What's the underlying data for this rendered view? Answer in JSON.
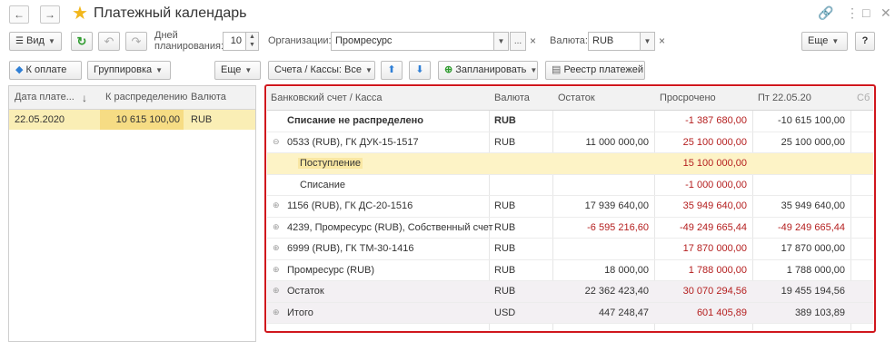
{
  "window": {
    "title": "Платежный календарь",
    "back_icon": "←",
    "forward_icon": "→",
    "star_icon": "★",
    "link_icon": "🔗",
    "menu_icon": "⋮",
    "maximize_icon": "□",
    "close_icon": "✕"
  },
  "toolbar1": {
    "view_label": "Вид",
    "refresh_icon": "↻",
    "undo_icon": "↶",
    "redo_icon": "↷",
    "days_label_1": "Дней",
    "days_label_2": "планирования:",
    "days_value": "10",
    "org_label": "Организации:",
    "org_value": "Промресурс",
    "currency_label": "Валюта:",
    "currency_value": "RUB",
    "more_label": "Еще",
    "help_label": "?",
    "clear_icon": "×",
    "dots_label": "..."
  },
  "toolbar2": {
    "pay_label": "К оплате",
    "group_label": "Группировка",
    "more_label": "Еще",
    "accounts_label": "Счета / Кассы: Все",
    "up_icon": "⬆",
    "down_icon": "⬇",
    "plan_label": "Запланировать",
    "registry_label": "Реестр платежей"
  },
  "left_table": {
    "headers": [
      "Дата плате...",
      "↓",
      "К распределению",
      "Валюта"
    ],
    "rows": [
      {
        "date": "22.05.2020",
        "amount": "10 615 100,00",
        "currency": "RUB"
      }
    ]
  },
  "right_table": {
    "headers": [
      "Банковский счет / Касса",
      "Валюта",
      "Остаток",
      "Просрочено",
      "Пт 22.05.20",
      "Сб"
    ],
    "rows": [
      {
        "name": "Списание не распределено",
        "currency": "RUB",
        "balance": "",
        "overdue": "-1 387 680,00",
        "day": "-10 615 100,00"
      },
      {
        "name": "0533 (RUB), ГК ДУК-15-1517",
        "currency": "RUB",
        "balance": "11 000 000,00",
        "overdue": "25 100 000,00",
        "day": "25 100 000,00"
      },
      {
        "name": "Поступление",
        "currency": "",
        "balance": "",
        "overdue": "15 100 000,00",
        "day": ""
      },
      {
        "name": "Списание",
        "currency": "",
        "balance": "",
        "overdue": "-1 000 000,00",
        "day": ""
      },
      {
        "name": "1156 (RUB), ГК ДС-20-1516",
        "currency": "RUB",
        "balance": "17 939 640,00",
        "overdue": "35 949 640,00",
        "day": "35 949 640,00"
      },
      {
        "name": "4239, Промресурс (RUB), Собственный счет",
        "currency": "RUB",
        "balance": "-6 595 216,60",
        "overdue": "-49 249 665,44",
        "day": "-49 249 665,44"
      },
      {
        "name": "6999 (RUB), ГК ТМ-30-1416",
        "currency": "RUB",
        "balance": "",
        "overdue": "17 870 000,00",
        "day": "17 870 000,00"
      },
      {
        "name": "Промресурс (RUB)",
        "currency": "RUB",
        "balance": "18 000,00",
        "overdue": "1 788 000,00",
        "day": "1 788 000,00"
      },
      {
        "name": "Остаток",
        "currency": "RUB",
        "balance": "22 362 423,40",
        "overdue": "30 070 294,56",
        "day": "19 455 194,56"
      },
      {
        "name": "Итого",
        "currency": "USD",
        "balance": "447 248,47",
        "overdue": "601 405,89",
        "day": "389 103,89"
      }
    ]
  },
  "colors": {
    "selection": "#faeeb5",
    "negative": "#b52020",
    "highlight_frame": "#d0171d",
    "star": "#f2b71c",
    "refresh_icon": "#2e9b2e",
    "arrow_icon": "#2f7fd6",
    "plan_icon": "#2e9b2e"
  }
}
